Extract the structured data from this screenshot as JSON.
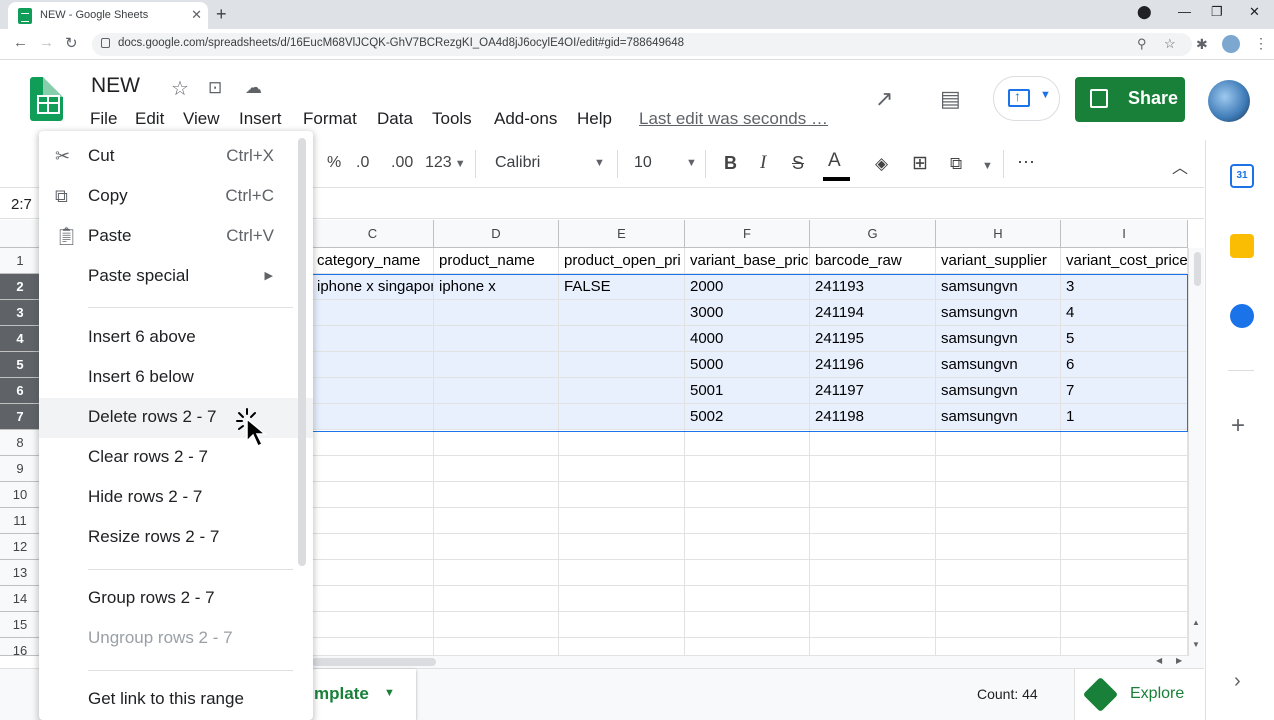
{
  "browser": {
    "tab_title": "NEW - Google Sheets",
    "url": "docs.google.com/spreadsheets/d/16EucM68VlJCQK-GhV7BCRezgKI_OA4d8jJ6ocylE4OI/edit#gid=788649648"
  },
  "doc": {
    "name": "NEW",
    "menus": [
      "File",
      "Edit",
      "View",
      "Insert",
      "Format",
      "Data",
      "Tools",
      "Add-ons",
      "Help"
    ],
    "last_edit": "Last edit was seconds …",
    "share_label": "Share"
  },
  "toolbar": {
    "percent": "%",
    "dec_less": ".0",
    "dec_more": ".00",
    "number_format": "123",
    "font": "Calibri",
    "font_size": "10",
    "bold": "B",
    "italic": "I",
    "strike": "S",
    "text_color_glyph": "A",
    "more": "⋯"
  },
  "formula_bar": {
    "name_box": "2:7"
  },
  "grid": {
    "columns": [
      "C",
      "D",
      "E",
      "F",
      "G",
      "H",
      "I"
    ],
    "row_numbers": [
      "1",
      "2",
      "3",
      "4",
      "5",
      "6",
      "7",
      "8",
      "9",
      "10",
      "11",
      "12",
      "13",
      "14",
      "15",
      "16"
    ],
    "selected_rows": [
      "2",
      "3",
      "4",
      "5",
      "6",
      "7"
    ],
    "header_row": [
      "category_name",
      "product_name",
      "product_open_pri",
      "variant_base_pric",
      "barcode_raw",
      "variant_supplier",
      "variant_cost_price"
    ],
    "data_rows": [
      [
        "iphone x singapore",
        "iphone x",
        "FALSE",
        "2000",
        "241193",
        "samsungvn",
        "3"
      ],
      [
        "",
        "",
        "",
        "3000",
        "241194",
        "samsungvn",
        "4"
      ],
      [
        "",
        "",
        "",
        "4000",
        "241195",
        "samsungvn",
        "5"
      ],
      [
        "",
        "",
        "",
        "5000",
        "241196",
        "samsungvn",
        "6"
      ],
      [
        "",
        "",
        "",
        "5001",
        "241197",
        "samsungvn",
        "7"
      ],
      [
        "",
        "",
        "",
        "5002",
        "241198",
        "samsungvn",
        "1"
      ]
    ]
  },
  "context_menu": {
    "items": [
      {
        "label": "Cut",
        "shortcut": "Ctrl+X",
        "icon": "scissors-icon"
      },
      {
        "label": "Copy",
        "shortcut": "Ctrl+C",
        "icon": "copy-icon"
      },
      {
        "label": "Paste",
        "shortcut": "Ctrl+V",
        "icon": "clipboard-icon"
      },
      {
        "label": "Paste special"
      },
      {
        "label": "Insert 6 above"
      },
      {
        "label": "Insert 6 below"
      },
      {
        "label": "Delete rows 2 - 7",
        "hovered": true
      },
      {
        "label": "Clear rows 2 - 7"
      },
      {
        "label": "Hide rows 2 - 7"
      },
      {
        "label": "Resize rows 2 - 7"
      },
      {
        "label": "Group rows 2 - 7"
      },
      {
        "label": "Ungroup rows 2 - 7",
        "disabled": true
      },
      {
        "label": "Get link to this range"
      }
    ]
  },
  "bottom": {
    "sheet_tab": "mplate",
    "count": "Count: 44",
    "explore": "Explore"
  },
  "side_panel": {
    "icons": [
      "calendar-icon",
      "keep-icon",
      "tasks-icon",
      "add-icon"
    ],
    "calendar_day": "31"
  },
  "colors": {
    "accent": "#1a73e8",
    "sheets_green": "#188038",
    "selection": "#e8f0fe"
  }
}
